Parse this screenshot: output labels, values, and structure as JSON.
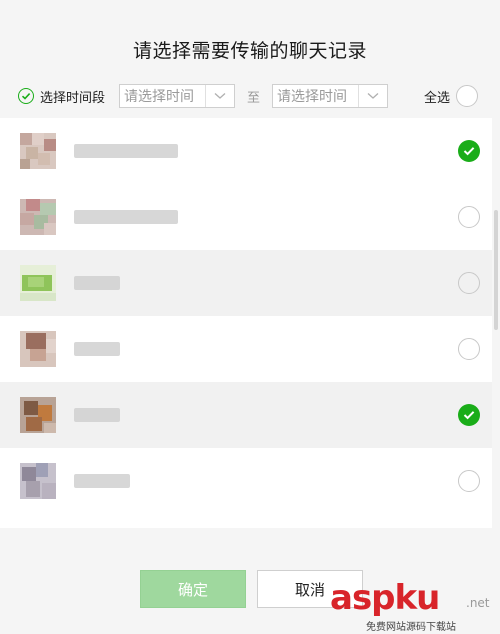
{
  "dialog": {
    "title": "请选择需要传输的聊天记录",
    "time_range_label": "选择时间段",
    "start_placeholder": "请选择时间",
    "to_label": "至",
    "end_placeholder": "请选择时间",
    "select_all_label": "全选"
  },
  "chats": [
    {
      "selected": true,
      "name_redacted": true
    },
    {
      "selected": false,
      "name_redacted": true
    },
    {
      "selected": false,
      "name_redacted": true
    },
    {
      "selected": false,
      "name_redacted": true
    },
    {
      "selected": true,
      "name_redacted": true
    },
    {
      "selected": false,
      "name_redacted": true
    }
  ],
  "buttons": {
    "confirm": "确定",
    "cancel": "取消"
  },
  "watermark": {
    "brand": "aspku",
    "suffix": ".net",
    "tagline": "免费网站源码下载站"
  },
  "colors": {
    "accent": "#1aad19",
    "confirm_disabled": "#9fd89e",
    "watermark": "#d8242a"
  }
}
